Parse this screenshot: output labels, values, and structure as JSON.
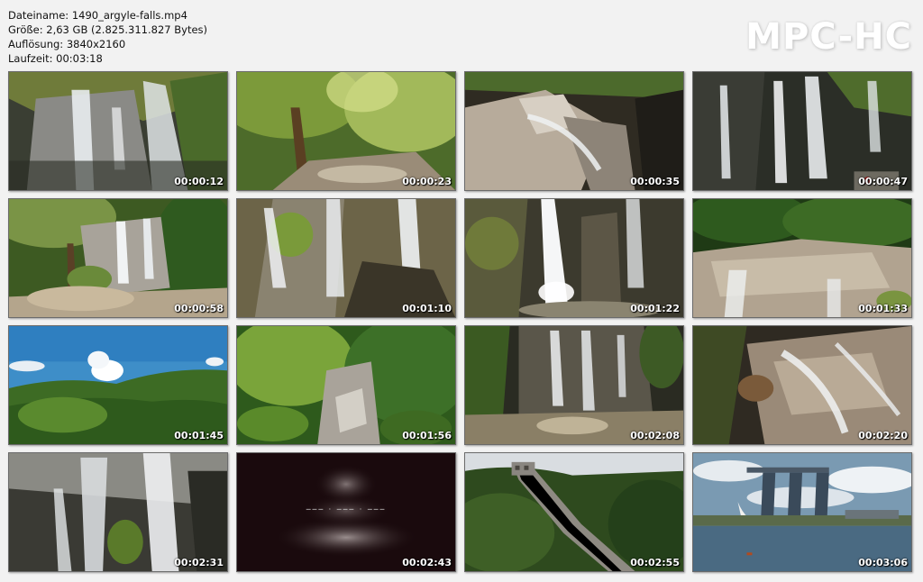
{
  "info": {
    "filename": "Dateiname: 1490_argyle-falls.mp4",
    "size": "Größe: 2,63 GB (2.825.311.827 Bytes)",
    "resolution": "Auflösung: 3840x2160",
    "duration": "Laufzeit: 00:03:18"
  },
  "logo": "MPC-HC",
  "thumbnails": [
    {
      "time": "00:00:12",
      "scene": "waterfall-rocks"
    },
    {
      "time": "00:00:23",
      "scene": "forest-stream"
    },
    {
      "time": "00:00:35",
      "scene": "rock-cascade"
    },
    {
      "time": "00:00:47",
      "scene": "waterfall-cliff"
    },
    {
      "time": "00:00:58",
      "scene": "forest-waterfall"
    },
    {
      "time": "00:01:10",
      "scene": "waterfall-closeup"
    },
    {
      "time": "00:01:22",
      "scene": "waterfall-bright"
    },
    {
      "time": "00:01:33",
      "scene": "rock-slab-trees"
    },
    {
      "time": "00:01:45",
      "scene": "sky-hills"
    },
    {
      "time": "00:01:56",
      "scene": "green-valley"
    },
    {
      "time": "00:02:08",
      "scene": "waterfall-wide"
    },
    {
      "time": "00:02:20",
      "scene": "cascade-rocks"
    },
    {
      "time": "00:02:31",
      "scene": "waterfall-grey"
    },
    {
      "time": "00:02:43",
      "scene": "title-smoke"
    },
    {
      "time": "00:02:55",
      "scene": "great-wall"
    },
    {
      "time": "00:03:06",
      "scene": "marina-bay"
    }
  ]
}
